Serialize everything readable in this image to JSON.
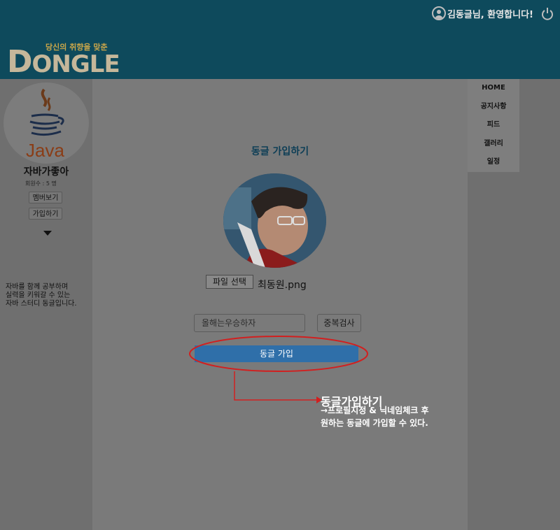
{
  "header": {
    "welcome": "김동글님, 환영합니다!",
    "logo_tagline": "당신의 취향을 맞춘",
    "logo_first": "D",
    "logo_rest": "ONGLE"
  },
  "sidebar": {
    "club_name": "자바가좋아",
    "member_count": "회원수 : 5 명",
    "member_button": "멤버보기",
    "join_button": "가입하기",
    "description_lines": [
      "자바를 함께 공부하며",
      "실력을 키워갈 수 있는",
      "자바 스터디 동글입니다."
    ]
  },
  "nav": {
    "items": [
      "HOME",
      "공지사항",
      "피드",
      "갤러리",
      "일정"
    ]
  },
  "form": {
    "title": "동글 가입하기",
    "file_button": "파일 선택",
    "file_name": "최동원.png",
    "nickname_value": "올해는우승하자",
    "dup_check_button": "중복검사",
    "join_button": "동글 가입"
  },
  "annotation": {
    "title": "동글가입하기",
    "line1": "→프로필지정 & 닉네임체크 후",
    "line2": "원하는 동글에 가입할 수 있다."
  },
  "colors": {
    "header_bg": "#0e4a5c",
    "accent_red": "#d21f1f",
    "join_button_bg": "#2f6fa9"
  }
}
